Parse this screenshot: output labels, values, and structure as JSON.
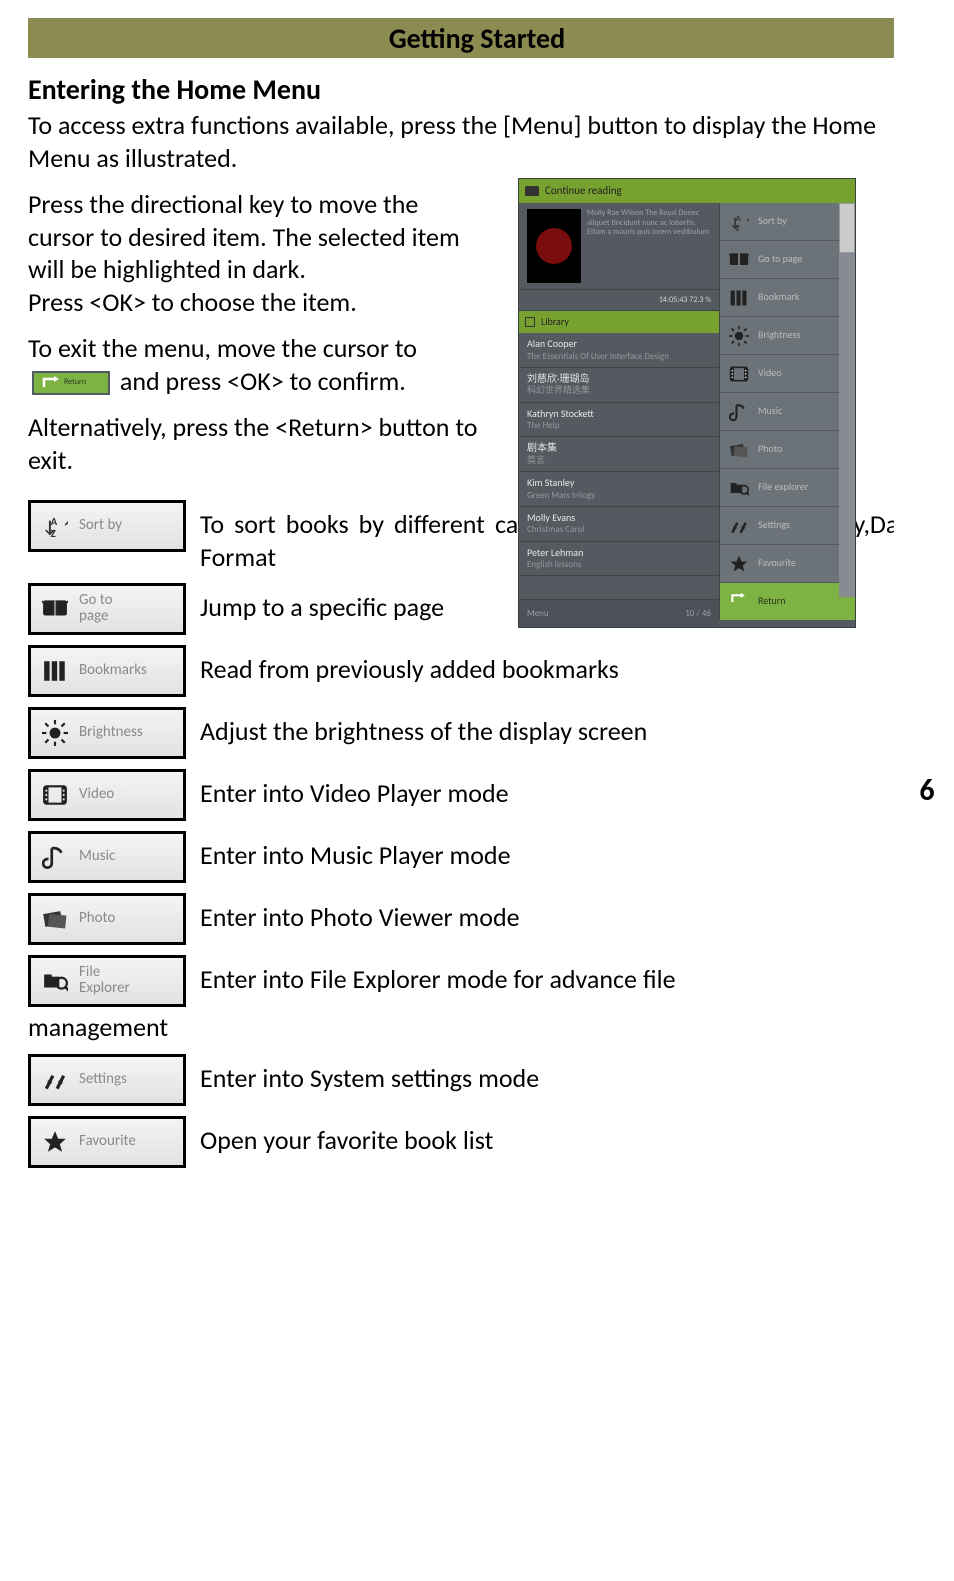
{
  "header": {
    "title": "Getting Started",
    "page": "6"
  },
  "section_heading": "Entering the Home Menu",
  "intro": "To access extra functions available, press the [Menu] button to display the Home Menu as illustrated.",
  "para1": "Press the directional key to move the cursor to desired item. The selected item will be highlighted in dark.",
  "para1b": "Press <OK> to choose the item.",
  "para2_pre": "To exit the menu, move the cursor to",
  "para2_post": "and press <OK> to confirm.",
  "para3": "Alternatively, press the <Return> button to exit.",
  "return_btn_label": "Return",
  "device": {
    "continue_reading": "Continue reading",
    "library_label": "Library",
    "cover_lines": "Molly Rae Wilson\nThe Royal\n\nDonec aliquet tincidunt nunc ac lobortis. Etiam a mauris quis lorem vestibulum",
    "cover_footer": "14:05:43   72.3 %",
    "rows": [
      {
        "t1": "Alan Cooper",
        "t2": "The Essentials Of User Interface Design"
      },
      {
        "t1": "刘慈欣·珊瑚岛",
        "t2": "科幻世界精选集"
      },
      {
        "t1": "Kathryn Stockett",
        "t2": "The Help"
      },
      {
        "t1": "剧本集",
        "t2": "莫言"
      },
      {
        "t1": "Kim Stanley",
        "t2": "Green Mars trilogy"
      },
      {
        "t1": "Molly Evans",
        "t2": "Christmas Carol"
      },
      {
        "t1": "Peter Lehman",
        "t2": "English lessons"
      }
    ],
    "footer_left": "Menu",
    "footer_right": "10 / 46",
    "side": [
      {
        "name": "sort-by",
        "label": "Sort by"
      },
      {
        "name": "go-to-page",
        "label": "Go to page"
      },
      {
        "name": "bookmark",
        "label": "Bookmark"
      },
      {
        "name": "brightness",
        "label": "Brightness"
      },
      {
        "name": "video",
        "label": "Video"
      },
      {
        "name": "music",
        "label": "Music"
      },
      {
        "name": "photo",
        "label": "Photo"
      },
      {
        "name": "file-explorer",
        "label": "File explorer"
      },
      {
        "name": "settings",
        "label": "Settings"
      },
      {
        "name": "favourite",
        "label": "Favourite"
      },
      {
        "name": "return",
        "label": "Return"
      }
    ]
  },
  "legend": [
    {
      "name": "sort-by",
      "label": "Sort by",
      "desc": "To sort books by different categories: Title, Author, Category,Date, Format"
    },
    {
      "name": "go-to-page",
      "label": "Go to\npage",
      "desc": "Jump to a specific page"
    },
    {
      "name": "bookmarks",
      "label": "Bookmarks",
      "desc": "Read from previously added bookmarks"
    },
    {
      "name": "brightness",
      "label": "Brightness",
      "desc": "Adjust the brightness of the display screen"
    },
    {
      "name": "video",
      "label": "Video",
      "desc": "Enter into Video Player mode"
    },
    {
      "name": "music",
      "label": "Music",
      "desc": "Enter into Music Player mode"
    },
    {
      "name": "photo",
      "label": "Photo",
      "desc": "Enter into Photo Viewer mode"
    },
    {
      "name": "file-explorer",
      "label": "File\nExplorer",
      "desc": "Enter into File Explorer mode for advance file",
      "cont": "management"
    },
    {
      "name": "settings",
      "label": "Settings",
      "desc": "Enter into System settings mode"
    },
    {
      "name": "favourite",
      "label": "Favourite",
      "desc": "Open your favorite book list"
    }
  ]
}
